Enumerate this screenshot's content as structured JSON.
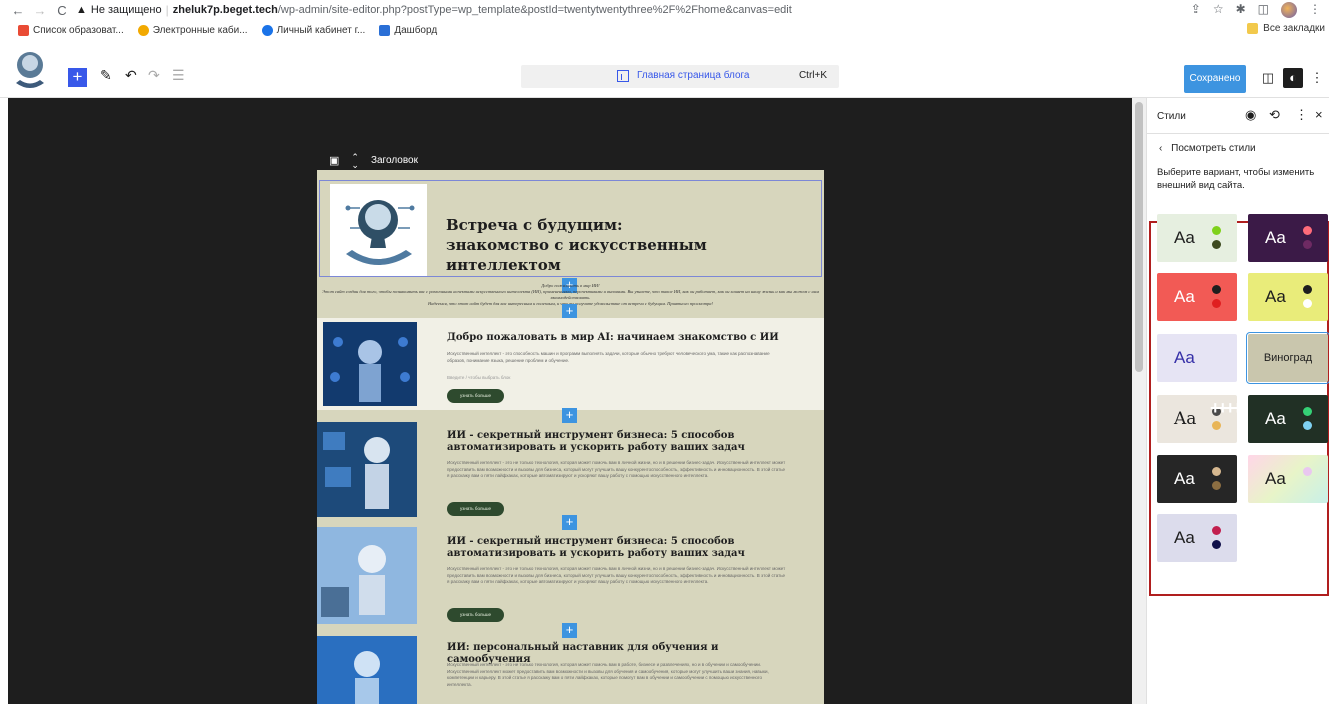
{
  "browser": {
    "security_label": "Не защищено",
    "url_host": "zheluk7p.beget.tech",
    "url_path": "/wp-admin/site-editor.php?postType=wp_template&postId=twentytwentythree%2F%2Fhome&canvas=edit",
    "bookmarks": [
      {
        "label": "Список образоват...",
        "color": "#e94b35"
      },
      {
        "label": "Электронные каби...",
        "color": "#f2a900"
      },
      {
        "label": "Личный кабинет г...",
        "color": "#1a73e8"
      },
      {
        "label": "Дашборд",
        "color": "#2a6fd6"
      }
    ],
    "all_bookmarks": "Все закладки"
  },
  "editor": {
    "document_title": "Главная страница блога",
    "shortcut": "Ctrl+K",
    "save_label": "Сохранено",
    "block_toolbar_label": "Заголовок"
  },
  "page": {
    "site_title_line1": "Встреча с будущим:",
    "site_title_line2": "знакомство с искусственным интеллектом",
    "intro_line1": "Добро пожаловать в мир ИИ!",
    "intro_line2": "Этот сайт создан для того, чтобы познакомить вас с различными аспектами искусственного интеллекта (ИИ), применениями, перспективами и вызовами. Вы узнаете, что такое ИИ, как он работает, как он влияет на нашу жизнь и как мы можем с ним взаимодействовать.",
    "intro_line3": "Надеемся, что этот сайт будет для вас интересным и полезным, и что вы получите удовольствие от встречи с будущим. Приятного просмотра!",
    "posts": [
      {
        "title": "Добро пожаловать в мир AI: начинаем знакомство с ИИ",
        "text": "Искусственный интеллект - это способность машин и программ выполнять задачи, которые обычно требуют человеческого ума, такие как распознавание образов, понимание языка, решение проблем и обучение.",
        "hint": "Введите / чтобы выбрать блок",
        "more": "узнать больше"
      },
      {
        "title": "ИИ - секретный инструмент бизнеса: 5 способов автоматизировать и ускорить работу ваших задач",
        "text": "Искусственный интеллект - это не только технология, которая может помочь вам в личной жизни, но и в решении бизнес-задач. Искусственный интеллект может предоставить вам возможности и вызовы для бизнеса, который могут улучшить вашу конкурентоспособность, эффективность и инновационность. В этой статье я расскажу вам о пяти лайфхаках, которые автоматизируют и ускоряют вашу работу с помощью искусственного интеллекта.",
        "more": "узнать больше"
      },
      {
        "title": "ИИ - секретный инструмент бизнеса: 5 способов автоматизировать и ускорить работу ваших задач",
        "text": "Искусственный интеллект - это не только технология, которая может помочь вам в личной жизни, но и в решении бизнес-задач. Искусственный интеллект может предоставить вам возможности и вызовы для бизнеса, который могут улучшить вашу конкурентоспособность, эффективность и инновационность. В этой статье я расскажу вам о пяти лайфхаках, которые автоматизируют и ускоряют вашу работу с помощью искусственного интеллекта.",
        "more": "узнать больше"
      },
      {
        "title": "ИИ: персональный наставник для обучения и самообучения",
        "text": "Искусственный интеллект - это не только технология, которая может помочь вам в работе, бизнесе и развлечениях, но и в обучении и самообучении. Искусственный интеллект может предоставить вам возможности и вызовы для обучения и самообучения, которые могут улучшить ваши знания, навыки, компетенции и карьеру. В этой статье я расскажу вам о пяти лайфхаках, которые помогут вам в обучении и самообучении с помощью искусственного интеллекта."
      }
    ]
  },
  "sidebar": {
    "title": "Стили",
    "back_label": "Посмотреть стили",
    "description": "Выберите вариант, чтобы изменить внешний вид сайта.",
    "variations": [
      {
        "label": "Aa",
        "bg": "#e6efe0",
        "fg": "#1e1e1e",
        "dot1": "#7fd11b",
        "dot2": "#3d4a1f",
        "selected": false
      },
      {
        "label": "Aa",
        "bg": "#3b1a47",
        "fg": "#ffffff",
        "dot1": "#ff6b7a",
        "dot2": "#6e2a63",
        "selected": false
      },
      {
        "label": "Aa",
        "bg": "#f25a55",
        "fg": "#ffffff",
        "dot1": "#1e1e1e",
        "dot2": "#e01f20",
        "selected": false
      },
      {
        "label": "Aa",
        "bg": "#e9ec7a",
        "fg": "#1e1e1e",
        "dot1": "#1e1e1e",
        "dot2": "#ffffff",
        "selected": false
      },
      {
        "label": "Aa",
        "bg": "#e6e4f4",
        "fg": "#3630a8",
        "dot1": "#e6e4f4",
        "dot2": "#e6e4f4",
        "selected": false
      },
      {
        "label": "Виноград",
        "bg": "#c9c6ad",
        "fg": "#1e1e1e",
        "selected": true
      },
      {
        "label": "Aa",
        "bg": "#ebe6de",
        "fg": "#1e1e1e",
        "dot1": "#4a4a4a",
        "dot2": "#e8b557",
        "selected": false
      },
      {
        "label": "Aa",
        "bg": "#213025",
        "fg": "#ffffff",
        "dot1": "#35d176",
        "dot2": "#7fd1f2",
        "selected": false
      },
      {
        "label": "Aa",
        "bg": "#262626",
        "fg": "#ffffff",
        "dot1": "#d6b890",
        "dot2": "#8c6e42",
        "selected": false
      },
      {
        "label": "Aa",
        "bg": "#f0f4e8",
        "fg": "#1e1e1e",
        "dot1": "#e9c7f0",
        "dot2": "#f0f4e8",
        "selected": false
      },
      {
        "label": "Aa",
        "bg": "#dcdcec",
        "fg": "#1e1e1e",
        "dot1": "#c21f4e",
        "dot2": "#10104a",
        "selected": false
      }
    ]
  }
}
